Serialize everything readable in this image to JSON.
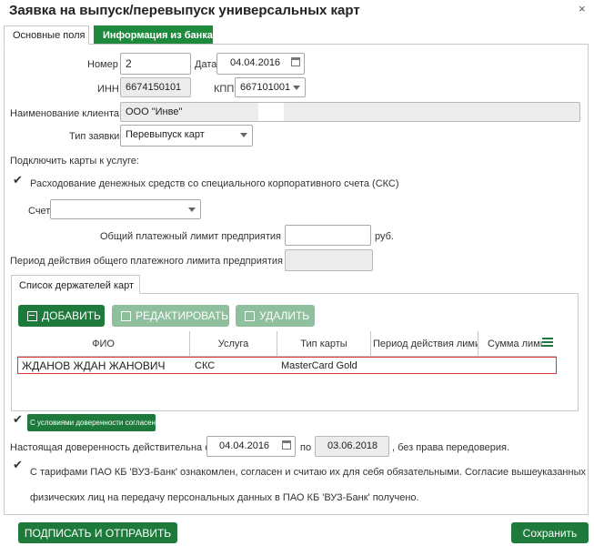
{
  "window": {
    "title": "Заявка на выпуск/перевыпуск универсальных карт",
    "close_glyph": "×"
  },
  "tabs": [
    {
      "label": "Основные поля",
      "active": true
    },
    {
      "label": "Информация из банка",
      "active": false
    }
  ],
  "form": {
    "number_label": "Номер",
    "number_value": "2",
    "date_label": "Дата",
    "date_value": "04.04.2016",
    "inn_label": "ИНН",
    "inn_value": "6674150101",
    "kpp_label": "КПП",
    "kpp_value": "667101001",
    "client_label": "Наименование клиента",
    "client_value": "ООО \"Инве\"",
    "request_type_label": "Тип заявки",
    "request_type_value": "Перевыпуск карт",
    "connect_heading": "Подключить карты к услуге:",
    "sks_checkbox_label": "Расходование денежных средств со специального корпоративного счета (СКС)",
    "account_label": "Счет",
    "account_value": "",
    "limit_label": "Общий платежный лимит предприятия",
    "limit_value": "",
    "limit_unit": "руб.",
    "period_label": "Период действия общего платежного лимита предприятия",
    "period_value": ""
  },
  "holders": {
    "tab_label": "Список держателей карт",
    "buttons": {
      "add": "ДОБАВИТЬ",
      "edit": "РЕДАКТИРОВАТЬ",
      "delete": "УДАЛИТЬ"
    },
    "columns": [
      "ФИО",
      "Услуга",
      "Тип карты",
      "Период действия лими",
      "Сумма лимит"
    ],
    "rows": [
      {
        "fio": "ЖДАНОВ ЖДАН ЖАНОВИЧ",
        "service": "СКС",
        "card_type": "MasterCard Gold",
        "period": "",
        "sum": ""
      }
    ]
  },
  "proxy": {
    "agree_button": "С условиями доверенности согласен",
    "valid_label": "Настоящая доверенность действительна с",
    "valid_from": "04.04.2016",
    "to_label": "по",
    "valid_to": "03.06.2018",
    "suffix": ", без права передоверия."
  },
  "tariffs": {
    "line1": "С тарифами ПАО КБ 'ВУЗ-Банк' ознакомлен, согласен и считаю их для себя обязательными. Согласие вышеуказанных",
    "line2": "физических лиц на передачу персональных данных в ПАО КБ 'ВУЗ-Банк' получено."
  },
  "footer": {
    "sign_button": "ПОДПИСАТЬ И ОТПРАВИТЬ",
    "save_button": "Сохранить"
  },
  "checkmark": "✔",
  "colors": {
    "accent": "#1d7a3a",
    "accent_disabled": "#8fbf9c",
    "selected_row_border": "#d93838"
  }
}
